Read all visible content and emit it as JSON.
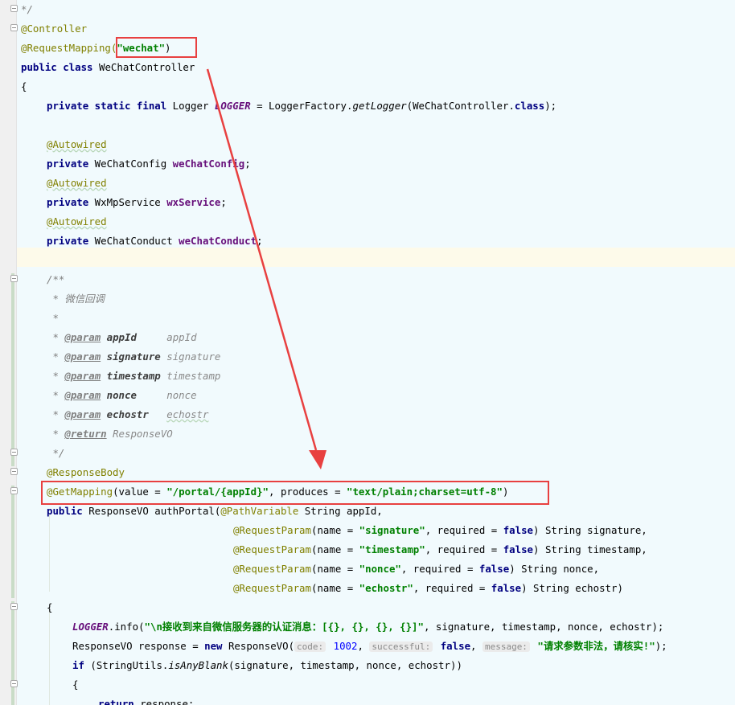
{
  "editor": {
    "lines": {
      "l01": "*/",
      "l02_ann": "@Controller",
      "l03_ann": "@RequestMapping(",
      "l03_str": "\"wechat\"",
      "l03_end": ")",
      "l04_kw": "public class",
      "l04_name": " WeChatController",
      "l05": "{",
      "l06_kw": "private static final",
      "l06_type": " Logger ",
      "l06_const": "LOGGER",
      "l06_mid": " = LoggerFactory.",
      "l06_method": "getLogger",
      "l06_arg": "(WeChatController.",
      "l06_kw2": "class",
      "l06_end": ");",
      "l08": "@Autowired",
      "l09_kw": "private",
      "l09_type": " WeChatConfig ",
      "l09_fld": "weChatConfig",
      "l09_end": ";",
      "l10": "@Autowired",
      "l11_kw": "private",
      "l11_type": " WxMpService ",
      "l11_fld": "wxService",
      "l11_end": ";",
      "l12": "@Autowired",
      "l13_kw": "private",
      "l13_type": " WeChatConduct ",
      "l13_fld": "weChatConduct",
      "l13_end": ";",
      "doc_open": "/**",
      "doc_desc": " * 微信回调",
      "doc_star": " *",
      "doc_end": " */",
      "params": [
        {
          "tag": "@param",
          "name": "appId",
          "val": "appId"
        },
        {
          "tag": "@param",
          "name": "signature",
          "val": "signature"
        },
        {
          "tag": "@param",
          "name": "timestamp",
          "val": "timestamp"
        },
        {
          "tag": "@param",
          "name": "nonce",
          "val": "nonce"
        },
        {
          "tag": "@param",
          "name": "echostr",
          "val": "echostr"
        }
      ],
      "ret_tag": "@return",
      "ret_val": "ResponseVO",
      "resp_body": "@ResponseBody",
      "gm_ann": "@GetMapping",
      "gm_a": "(value = ",
      "gm_path": "\"/portal/{appId}\"",
      "gm_b": ", produces = ",
      "gm_ct": "\"text/plain;charset=utf-8\"",
      "gm_c": ")",
      "sig_kw": "public",
      "sig_a": " ResponseVO authPortal(",
      "sig_ann": "@PathVariable",
      "sig_b": " String appId,",
      "rp_ann": "@RequestParam",
      "rp_name": "(name = ",
      "rp_req": ", required = ",
      "rp_false": "false",
      "rp_signature_str": "\"signature\"",
      "rp_signature_tail": ") String signature,",
      "rp_timestamp_str": "\"timestamp\"",
      "rp_timestamp_tail": ") String timestamp,",
      "rp_nonce_str": "\"nonce\"",
      "rp_nonce_tail": ") String nonce,",
      "rp_echostr_str": "\"echostr\"",
      "rp_echostr_tail": ") String echostr)",
      "brace_open": "{",
      "log_const": "LOGGER",
      "log_a": ".info(",
      "log_str": "\"\\n接收到来自微信服务器的认证消息：[{}, {}, {}, {}]\"",
      "log_b": ", signature, timestamp, nonce, echostr);",
      "resp_a": "ResponseVO response = ",
      "resp_kw": "new",
      "resp_b": " ResponseVO(",
      "hint_code": "code:",
      "resp_code": " 1002",
      "resp_c": ", ",
      "hint_successful": "successful:",
      "resp_false": " false",
      "resp_d": ", ",
      "hint_message": "message:",
      "resp_msg": " \"请求参数非法，请核实!\"",
      "resp_e": ");",
      "if_kw": "if",
      "if_a": " (StringUtils.",
      "if_method": "isAnyBlank",
      "if_b": "(signature, timestamp, nonce, echostr))",
      "brace2": "{",
      "ret_kw": "return",
      "ret_b": " response;"
    }
  },
  "colors": {
    "annotation_box": "#e84040",
    "arrow": "#e84040"
  }
}
